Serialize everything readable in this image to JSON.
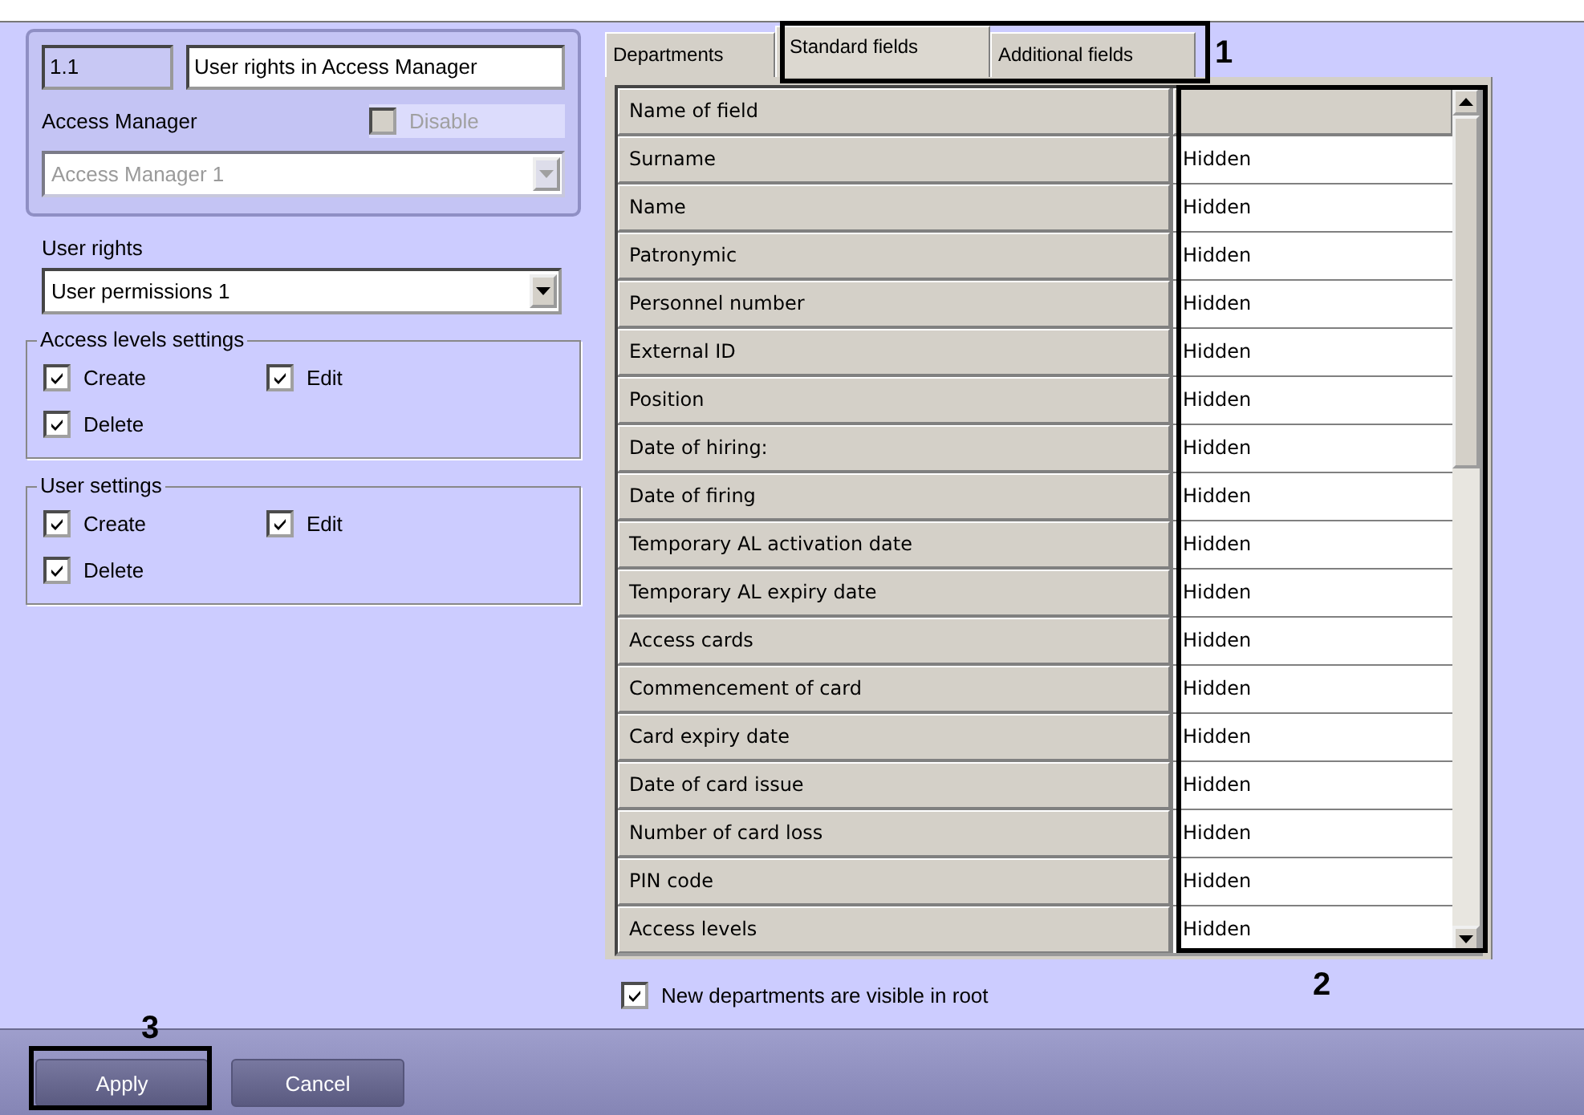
{
  "identity": {
    "number": "1.1",
    "name": "User rights in Access Manager"
  },
  "access_manager": {
    "label": "Access Manager",
    "disable": {
      "label": "Disable",
      "checked": false,
      "disabled": true
    },
    "dropdown": {
      "value": "Access Manager 1",
      "disabled": true
    }
  },
  "user_rights": {
    "label": "User rights",
    "dropdown": {
      "value": "User permissions 1",
      "disabled": false
    }
  },
  "groups": [
    {
      "title": "Access levels settings",
      "options": [
        {
          "label": "Create",
          "checked": true
        },
        {
          "label": "Edit",
          "checked": true
        },
        {
          "label": "Delete",
          "checked": true
        }
      ]
    },
    {
      "title": "User settings",
      "options": [
        {
          "label": "Create",
          "checked": true
        },
        {
          "label": "Edit",
          "checked": true
        },
        {
          "label": "Delete",
          "checked": true
        }
      ]
    }
  ],
  "tabs": [
    {
      "label": "Departments",
      "selected": false
    },
    {
      "label": "Standard fields",
      "selected": true
    },
    {
      "label": "Additional fields",
      "selected": false
    }
  ],
  "table": {
    "columns": [
      "Name of field"
    ],
    "rows": [
      {
        "field": "Surname",
        "value": "Hidden"
      },
      {
        "field": "Name",
        "value": "Hidden"
      },
      {
        "field": "Patronymic",
        "value": "Hidden"
      },
      {
        "field": "Personnel number",
        "value": "Hidden"
      },
      {
        "field": "External ID",
        "value": "Hidden"
      },
      {
        "field": "Position",
        "value": "Hidden"
      },
      {
        "field": "Date of hiring:",
        "value": "Hidden"
      },
      {
        "field": "Date of firing",
        "value": "Hidden"
      },
      {
        "field": "Temporary AL activation date",
        "value": "Hidden"
      },
      {
        "field": "Temporary AL expiry date",
        "value": "Hidden"
      },
      {
        "field": "Access cards",
        "value": "Hidden"
      },
      {
        "field": "Commencement of card",
        "value": "Hidden"
      },
      {
        "field": "Card expiry date",
        "value": "Hidden"
      },
      {
        "field": "Date of card issue",
        "value": "Hidden"
      },
      {
        "field": "Number of card loss",
        "value": "Hidden"
      },
      {
        "field": "PIN code",
        "value": "Hidden"
      },
      {
        "field": "Access levels",
        "value": "Hidden"
      }
    ]
  },
  "root_option": {
    "label": "New departments are visible in root",
    "checked": true
  },
  "buttons": [
    {
      "label": "Apply"
    },
    {
      "label": "Cancel"
    }
  ],
  "callouts": [
    {
      "label": "1"
    },
    {
      "label": "2"
    },
    {
      "label": "3"
    }
  ]
}
